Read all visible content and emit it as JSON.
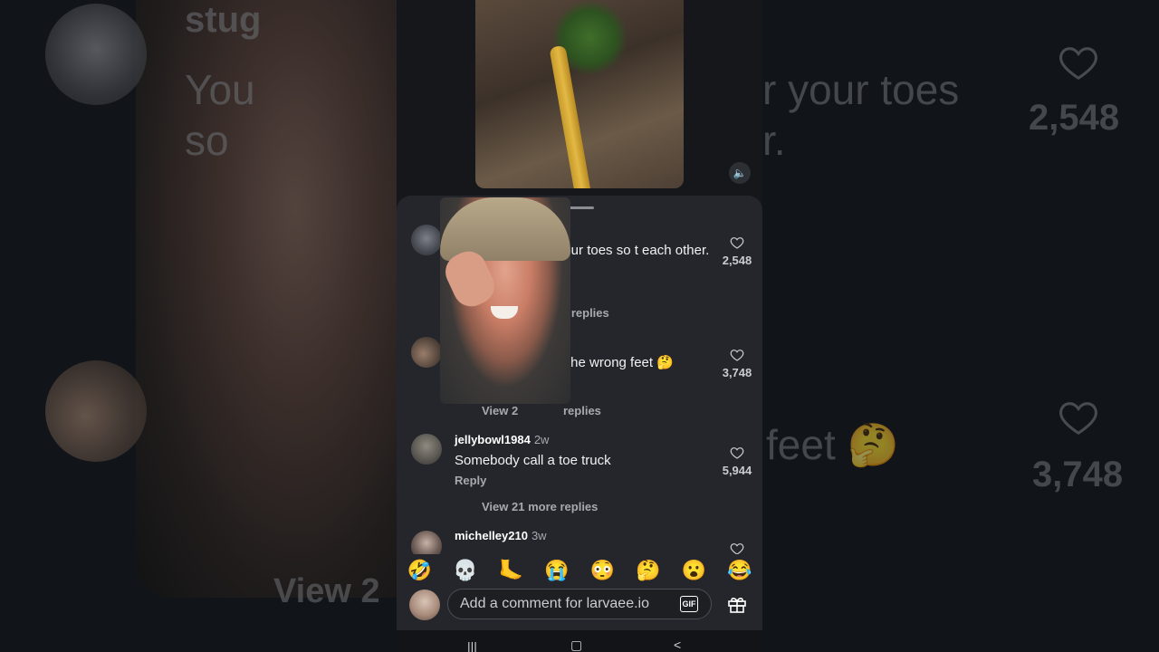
{
  "background": {
    "user_partial": "stug",
    "text_line1_partial": "You",
    "text_line1_end": "r your toes",
    "text_line2_partial": "so",
    "text_line2_end": "r.",
    "likes1": "2,548",
    "text2_end": "feet 🤔",
    "likes2": "3,748",
    "view_partial": "View 2"
  },
  "video": {
    "volume_icon": "🔈"
  },
  "comments": [
    {
      "user": "stug",
      "time": "",
      "text": "You       y a party for your toes so        t each other.",
      "likes": "2,548",
      "view_more": "e replies"
    },
    {
      "user": "",
      "time": "",
      "text": "the wrong feet 🤔",
      "likes": "3,748",
      "view_more_left": "View 2",
      "view_more": "replies"
    },
    {
      "user": "jellybowl1984",
      "time": "2w",
      "text": "Somebody call a toe truck",
      "reply": "Reply",
      "likes": "5,944",
      "view_more": "View 21 more replies"
    },
    {
      "user": "michelley210",
      "time": "3w"
    }
  ],
  "emojis": [
    "🤣",
    "💀",
    "🦶",
    "😭",
    "😳",
    "🤔",
    "😮",
    "😂"
  ],
  "comment_bar": {
    "placeholder": "Add a comment for larvaee.io",
    "gif_label": "GIF"
  },
  "nav": {
    "recents": "|||",
    "home": "▢",
    "back": "<"
  },
  "colors": {
    "sheet": "#24262b",
    "accent_text": "#a6a9ae"
  }
}
